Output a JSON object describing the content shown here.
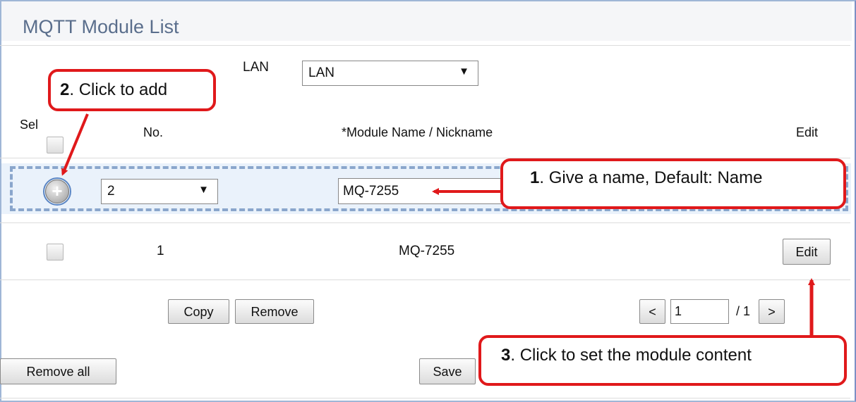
{
  "header": {
    "title": "MQTT Module List"
  },
  "lan": {
    "label": "LAN",
    "selected": "LAN"
  },
  "table": {
    "headers": {
      "select": "Sel",
      "no": "No.",
      "name": "*Module Name / Nickname",
      "edit": "Edit"
    },
    "new_row": {
      "no_selected": "2",
      "name_value": "MQ-7255"
    },
    "rows": [
      {
        "no": "1",
        "name": "MQ-7255",
        "edit_label": "Edit"
      }
    ]
  },
  "actions": {
    "copy": "Copy",
    "remove": "Remove",
    "remove_all": "Remove all",
    "save": "Save"
  },
  "pagination": {
    "prev": "<",
    "current": "1",
    "total": "/ 1",
    "next": ">"
  },
  "callouts": {
    "c1": {
      "num": "1",
      "text": ". Give a name, Default: Name"
    },
    "c2": {
      "num": "2",
      "text": ". Click to add"
    },
    "c3": {
      "num": "3",
      "text": ". Click to set the module content"
    }
  },
  "colors": {
    "callout_red": "#e0191b",
    "title_blue": "#5a6e8c",
    "new_row_bg": "#eaf2fb"
  }
}
